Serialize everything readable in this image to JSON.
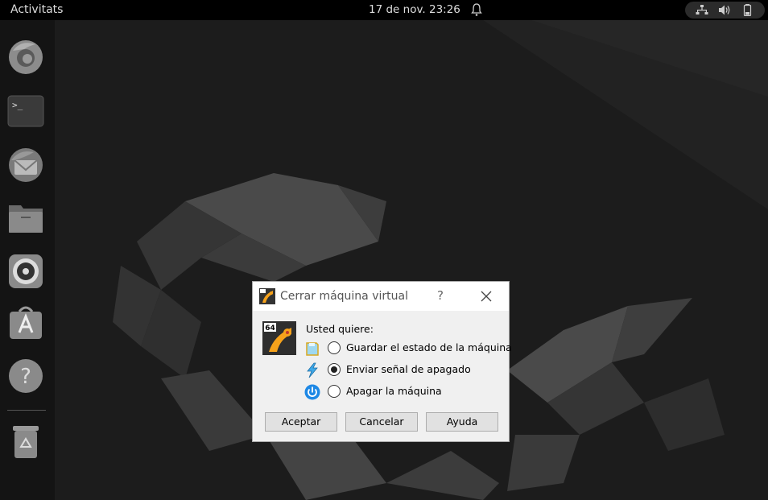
{
  "topbar": {
    "activities_label": "Activitats",
    "clock": "17 de nov.  23:26",
    "icons": [
      "bell-icon",
      "network-icon",
      "volume-icon",
      "battery-icon"
    ]
  },
  "dock": {
    "items": [
      "firefox-icon",
      "terminal-icon",
      "thunderbird-icon",
      "files-icon",
      "rhythmbox-icon",
      "app-center-icon",
      "help-icon",
      "trash-icon"
    ],
    "terminal_glyph": ">_"
  },
  "dialog": {
    "title": "Cerrar máquina virtual",
    "help_glyph": "?",
    "badge": "64",
    "prompt": "Usted quiere:",
    "options": [
      {
        "label": "Guardar el estado de la máquina",
        "icon": "save-state-icon",
        "selected": false
      },
      {
        "label": "Enviar señal de apagado",
        "icon": "acpi-shutdown-icon",
        "selected": true
      },
      {
        "label": "Apagar la máquina",
        "icon": "power-off-icon",
        "selected": false
      }
    ],
    "buttons": {
      "ok": "Aceptar",
      "cancel": "Cancelar",
      "help": "Ayuda"
    }
  },
  "colors": {
    "topbar": "#000000",
    "dock": "#141414",
    "wallpaper": "#1b1b1b",
    "dialog_bg": "#f0f0f0",
    "accent_blue": "#1e88e5"
  }
}
